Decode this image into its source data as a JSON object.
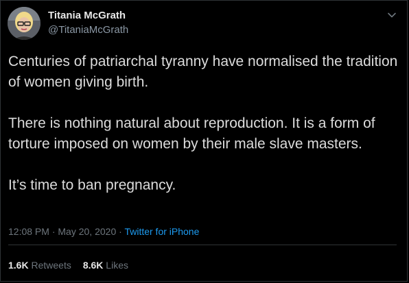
{
  "user": {
    "display_name": "Titania McGrath",
    "handle": "@TitaniaMcGrath"
  },
  "tweet": {
    "paragraphs": [
      "Centuries of patriarchal tyranny have normalised the tradition of women giving birth.",
      "There is nothing natural about reproduction. It is a form of torture imposed on women by their male slave masters.",
      "It’s time to ban pregnancy."
    ]
  },
  "meta": {
    "time": "12:08 PM",
    "separator": " · ",
    "date": "May 20, 2020",
    "source": "Twitter for iPhone"
  },
  "stats": {
    "retweets_count": "1.6K",
    "retweets_label": "Retweets",
    "likes_count": "8.6K",
    "likes_label": "Likes"
  },
  "colors": {
    "background": "#000000",
    "link": "#1d9bf0",
    "muted": "#6e767d"
  },
  "icons": {
    "menu": "chevron-down-icon"
  }
}
